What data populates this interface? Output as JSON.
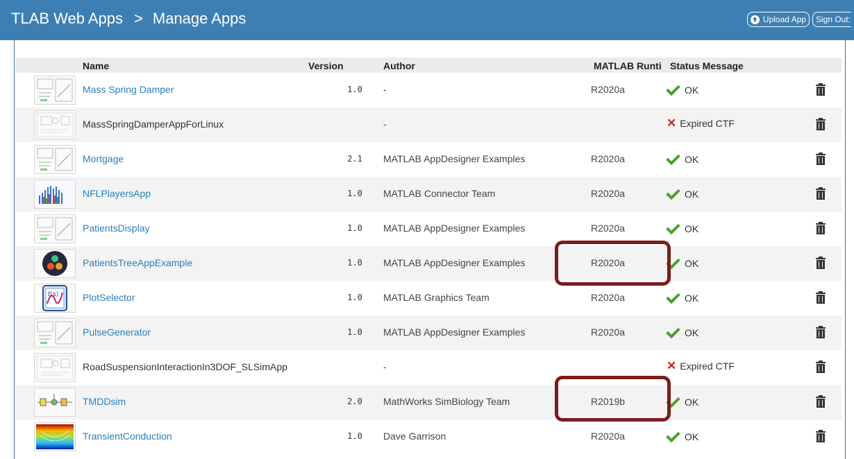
{
  "header": {
    "title": "TLAB Web Apps",
    "separator": ">",
    "page": "Manage Apps",
    "upload_label": "Upload App",
    "signout_label": "Sign Out:"
  },
  "table": {
    "columns": [
      "Name",
      "Version",
      "Author",
      "MATLAB Runti",
      "Status Message"
    ],
    "rows": [
      {
        "name": "Mass Spring Damper",
        "link": true,
        "version": "1.0",
        "author": "-",
        "runtime": "R2020a",
        "status": "OK",
        "ok": true,
        "thumb": "ui"
      },
      {
        "name": "MassSpringDamperAppForLinux",
        "link": false,
        "version": "",
        "author": "-",
        "runtime": "",
        "status": "Expired CTF",
        "ok": false,
        "thumb": "placeholder"
      },
      {
        "name": "Mortgage",
        "link": true,
        "version": "2.1",
        "author": "MATLAB AppDesigner Examples",
        "runtime": "R2020a",
        "status": "OK",
        "ok": true,
        "thumb": "ui"
      },
      {
        "name": "NFLPlayersApp",
        "link": true,
        "version": "1.0",
        "author": "MATLAB Connector Team",
        "runtime": "R2020a",
        "status": "OK",
        "ok": true,
        "thumb": "bars"
      },
      {
        "name": "PatientsDisplay",
        "link": true,
        "version": "1.0",
        "author": "MATLAB AppDesigner Examples",
        "runtime": "R2020a",
        "status": "OK",
        "ok": true,
        "thumb": "ui"
      },
      {
        "name": "PatientsTreeAppExample",
        "link": true,
        "version": "1.0",
        "author": "MATLAB AppDesigner Examples",
        "runtime": "R2020a",
        "status": "OK",
        "ok": true,
        "thumb": "tree"
      },
      {
        "name": "PlotSelector",
        "link": true,
        "version": "1.0",
        "author": "MATLAB Graphics Team",
        "runtime": "R2020a",
        "status": "OK",
        "ok": true,
        "thumb": "plot"
      },
      {
        "name": "PulseGenerator",
        "link": true,
        "version": "1.0",
        "author": "MATLAB AppDesigner Examples",
        "runtime": "R2020a",
        "status": "OK",
        "ok": true,
        "thumb": "ui"
      },
      {
        "name": "RoadSuspensionInteractionIn3DOF_SLSimApp",
        "link": false,
        "version": "",
        "author": "-",
        "runtime": "",
        "status": "Expired CTF",
        "ok": false,
        "thumb": "placeholder"
      },
      {
        "name": "TMDDsim",
        "link": true,
        "version": "2.0",
        "author": "MathWorks SimBiology Team",
        "runtime": "R2019b",
        "status": "OK",
        "ok": true,
        "thumb": "diagram"
      },
      {
        "name": "TransientConduction",
        "link": true,
        "version": "1.0",
        "author": "Dave Garrison",
        "runtime": "R2020a",
        "status": "OK",
        "ok": true,
        "thumb": "heat"
      }
    ]
  },
  "colors": {
    "header": "#3d7fb3",
    "link": "#2b7fb9",
    "ok": "#4aa02c",
    "error": "#d32020",
    "highlight": "#7b1c1c"
  }
}
